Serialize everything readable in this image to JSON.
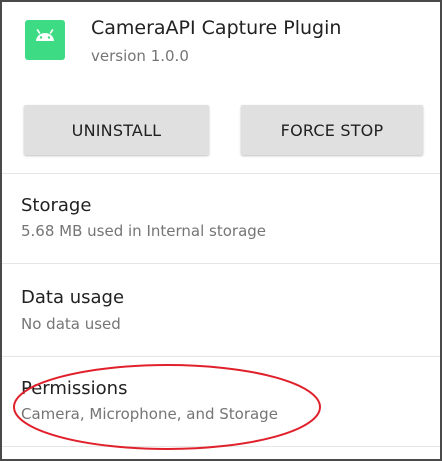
{
  "app": {
    "name": "CameraAPI Capture Plugin",
    "version": "version 1.0.0",
    "icon": "android-icon",
    "icon_color": "#3ddc84"
  },
  "buttons": {
    "uninstall": "UNINSTALL",
    "force_stop": "FORCE STOP"
  },
  "sections": {
    "storage": {
      "title": "Storage",
      "summary": "5.68 MB used in Internal storage"
    },
    "data_usage": {
      "title": "Data usage",
      "summary": "No data used"
    },
    "permissions": {
      "title": "Permissions",
      "summary": "Camera, Microphone, and Storage"
    }
  },
  "annotation": {
    "shape": "ellipse",
    "color": "#e0212b"
  }
}
